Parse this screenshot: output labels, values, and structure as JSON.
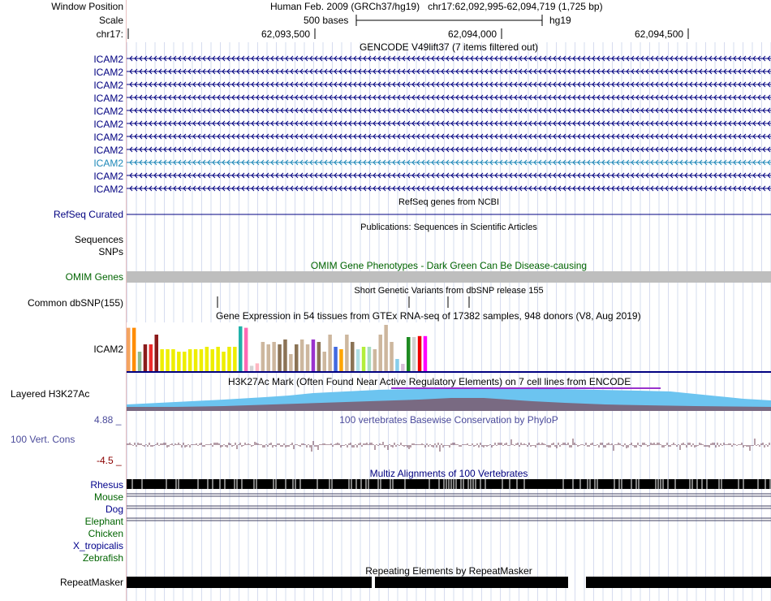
{
  "header": {
    "window_position_label": "Window Position",
    "window_position_value": "Human Feb. 2009 (GRCh37/hg19)   chr17:62,092,995-62,094,719 (1,725 bp)",
    "scale_label": "Scale",
    "scale_value": "500 bases",
    "assembly": "hg19",
    "chrom_label": "chr17:",
    "ruler_ticks": [
      "62,093,500",
      "62,094,000",
      "62,094,500"
    ]
  },
  "gencode": {
    "title": "GENCODE V49lift37 (7 items filtered out)",
    "items": [
      "ICAM2",
      "ICAM2",
      "ICAM2",
      "ICAM2",
      "ICAM2",
      "ICAM2",
      "ICAM2",
      "ICAM2",
      "ICAM2",
      "ICAM2",
      "ICAM2"
    ],
    "highlight_index": 8
  },
  "refseq": {
    "title": "RefSeq genes from NCBI",
    "label": "RefSeq Curated"
  },
  "publications": {
    "title": "Publications: Sequences in Scientific Articles",
    "label1": "Sequences",
    "label2": "SNPs"
  },
  "omim": {
    "title": "OMIM Gene Phenotypes - Dark Green Can Be Disease-causing",
    "label": "OMIM Genes"
  },
  "dbsnp": {
    "title": "Short Genetic Variants from dbSNP release 155",
    "label": "Common dbSNP(155)"
  },
  "gtex": {
    "title": "Gene Expression in 54 tissues from GTEx RNA-seq of 17382 samples, 948 donors (V8, Aug 2019)",
    "label": "ICAM2",
    "bars": [
      {
        "h": 0.89,
        "c": "#f4a460"
      },
      {
        "h": 0.89,
        "c": "#ff8c00"
      },
      {
        "h": 0.4,
        "c": "#8fbc8f"
      },
      {
        "h": 0.55,
        "c": "#8b1a1a"
      },
      {
        "h": 0.55,
        "c": "#ee2c2c"
      },
      {
        "h": 0.75,
        "c": "#8b1a1a"
      },
      {
        "h": 0.45,
        "c": "#eeee00"
      },
      {
        "h": 0.45,
        "c": "#eeee00"
      },
      {
        "h": 0.45,
        "c": "#eeee00"
      },
      {
        "h": 0.4,
        "c": "#eeee00"
      },
      {
        "h": 0.4,
        "c": "#eeee00"
      },
      {
        "h": 0.45,
        "c": "#eeee00"
      },
      {
        "h": 0.45,
        "c": "#eeee00"
      },
      {
        "h": 0.45,
        "c": "#eeee00"
      },
      {
        "h": 0.5,
        "c": "#eeee00"
      },
      {
        "h": 0.45,
        "c": "#eeee00"
      },
      {
        "h": 0.5,
        "c": "#eeee00"
      },
      {
        "h": 0.4,
        "c": "#eeee00"
      },
      {
        "h": 0.5,
        "c": "#eeee00"
      },
      {
        "h": 0.5,
        "c": "#eeee00"
      },
      {
        "h": 0.92,
        "c": "#20b2aa"
      },
      {
        "h": 0.89,
        "c": "#ff69b4"
      },
      {
        "h": 0.11,
        "c": "#d3d3d3"
      },
      {
        "h": 0.16,
        "c": "#ffb6c1"
      },
      {
        "h": 0.6,
        "c": "#cdb79e"
      },
      {
        "h": 0.55,
        "c": "#cdb79e"
      },
      {
        "h": 0.6,
        "c": "#cdb79e"
      },
      {
        "h": 0.55,
        "c": "#8b7355"
      },
      {
        "h": 0.65,
        "c": "#8b7355"
      },
      {
        "h": 0.35,
        "c": "#cdb79e"
      },
      {
        "h": 0.55,
        "c": "#8b7355"
      },
      {
        "h": 0.65,
        "c": "#cdb79e"
      },
      {
        "h": 0.55,
        "c": "#cdb79e"
      },
      {
        "h": 0.65,
        "c": "#9a32cd"
      },
      {
        "h": 0.6,
        "c": "#8b7355"
      },
      {
        "h": 0.4,
        "c": "#cdb79e"
      },
      {
        "h": 0.75,
        "c": "#cdb79e"
      },
      {
        "h": 0.5,
        "c": "#4169e1"
      },
      {
        "h": 0.45,
        "c": "#ffa500"
      },
      {
        "h": 0.75,
        "c": "#cdb79e"
      },
      {
        "h": 0.6,
        "c": "#8b7355"
      },
      {
        "h": 0.45,
        "c": "#b0e0e6"
      },
      {
        "h": 0.5,
        "c": "#b3ee3a"
      },
      {
        "h": 0.5,
        "c": "#a8dcc0"
      },
      {
        "h": 0.45,
        "c": "#cdb79e"
      },
      {
        "h": 0.75,
        "c": "#cdb79e"
      },
      {
        "h": 0.95,
        "c": "#cdb79e"
      },
      {
        "h": 0.6,
        "c": "#cdb79e"
      },
      {
        "h": 0.25,
        "c": "#87ceeb"
      },
      {
        "h": 0.15,
        "c": "#d8bfd8"
      },
      {
        "h": 0.7,
        "c": "#1e8b22"
      },
      {
        "h": 0.7,
        "c": "#d0d0d0"
      },
      {
        "h": 0.72,
        "c": "#ee0000"
      },
      {
        "h": 0.72,
        "c": "#ff00ff"
      }
    ]
  },
  "h3k27ac": {
    "title": "H3K27Ac Mark (Often Found Near Active Regulatory Elements) on 7 cell lines from ENCODE",
    "label": "Layered H3K27Ac"
  },
  "phylop": {
    "title": "100 vertebrates Basewise Conservation by PhyloP",
    "label": "100 Vert. Cons",
    "max": "4.88 _",
    "min": "-4.5 _"
  },
  "multiz": {
    "title": "Multiz Alignments of 100 Vertebrates",
    "species": [
      {
        "name": "Rhesus",
        "color": "#00008b"
      },
      {
        "name": "Mouse",
        "color": "#006400"
      },
      {
        "name": "Dog",
        "color": "#00008b"
      },
      {
        "name": "Elephant",
        "color": "#006400"
      },
      {
        "name": "Chicken",
        "color": "#006400"
      },
      {
        "name": "X_tropicalis",
        "color": "#00008b"
      },
      {
        "name": "Zebrafish",
        "color": "#006400"
      }
    ]
  },
  "repeatmasker": {
    "title": "Repeating Elements by RepeatMasker",
    "label": "RepeatMasker"
  }
}
